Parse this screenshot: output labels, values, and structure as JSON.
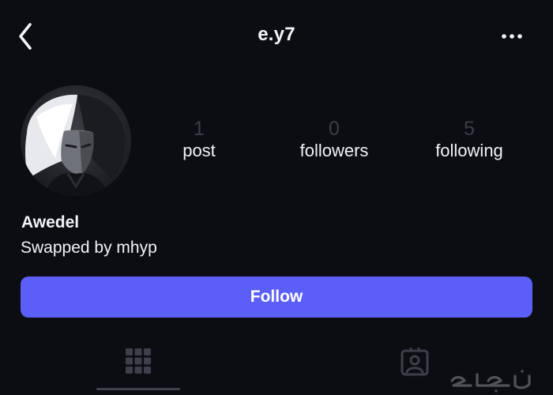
{
  "header": {
    "back_icon": "chevron-left-icon",
    "username": "e.y7",
    "more_icon": "more-horizontal-icon"
  },
  "profile": {
    "avatar_icon": "profile-avatar",
    "stats": [
      {
        "value": "1",
        "label": "post"
      },
      {
        "value": "0",
        "label": "followers"
      },
      {
        "value": "5",
        "label": "following"
      }
    ],
    "display_name": "Awedel",
    "bio": "Swapped by mhyp"
  },
  "actions": {
    "follow_label": "Follow"
  },
  "tabs": [
    {
      "icon": "grid-icon",
      "active": true
    },
    {
      "icon": "tagged-person-icon",
      "active": false
    }
  ],
  "watermark": {
    "text": "حراج"
  },
  "colors": {
    "background": "#0c0d12",
    "accent": "#5c5ff7",
    "stat_number": "#3b3e48",
    "text": "#f2f3f5",
    "tab_inactive": "#3d404a"
  }
}
